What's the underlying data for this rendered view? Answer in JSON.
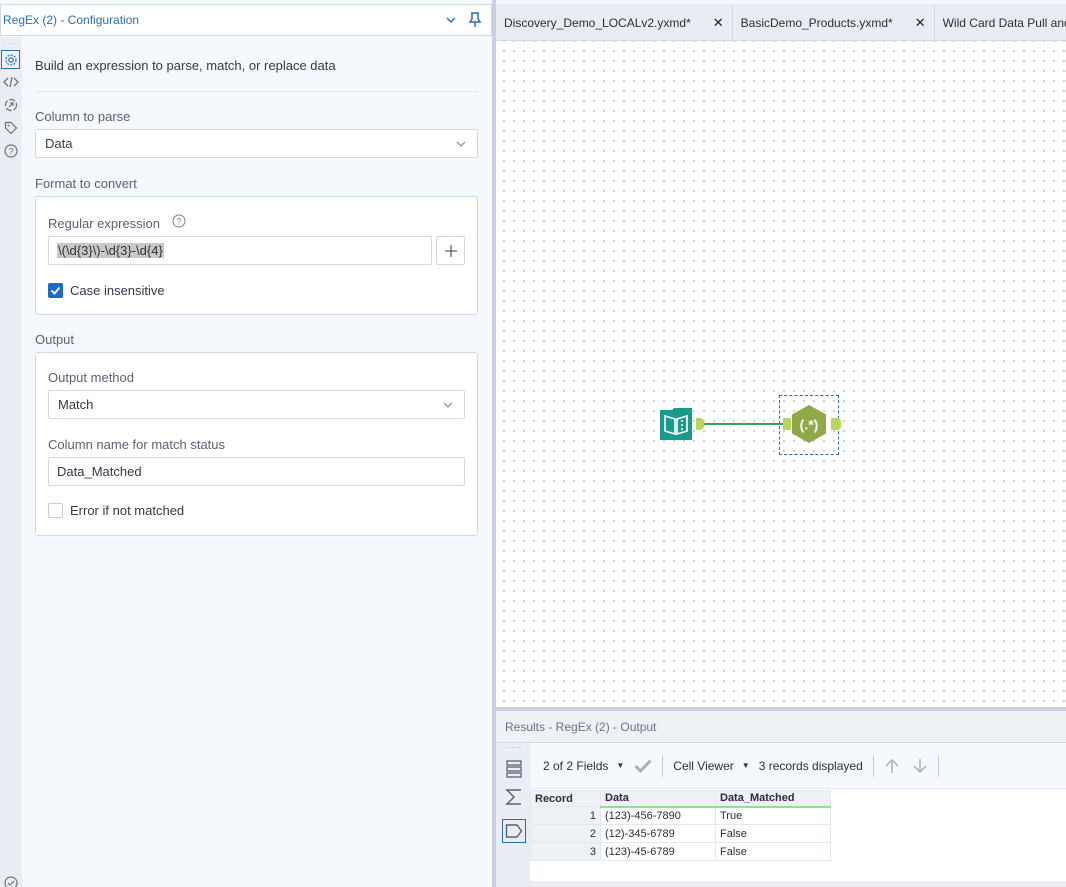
{
  "config": {
    "title": "RegEx (2) - Configuration",
    "description": "Build an expression to parse, match, or replace data",
    "column_to_parse": {
      "label": "Column to parse",
      "value": "Data"
    },
    "format_to_convert": {
      "label": "Format to convert",
      "regex_label": "Regular expression",
      "regex_value": "\\(\\d{3}\\)-\\d{3}-\\d{4}",
      "case_insensitive": {
        "label": "Case insensitive",
        "checked": true
      }
    },
    "output": {
      "label": "Output",
      "method_label": "Output method",
      "method_value": "Match",
      "match_column_label": "Column name for match status",
      "match_column_value": "Data_Matched",
      "error_if_not_matched": {
        "label": "Error if not matched",
        "checked": false
      }
    },
    "rail_icons": [
      "gear-icon",
      "code-icon",
      "run-icon",
      "tag-icon",
      "help-icon"
    ]
  },
  "tabs": [
    {
      "label": "Discovery_Demo_LOCALv2.yxmd*",
      "closable": true
    },
    {
      "label": "BasicDemo_Products.yxmd*",
      "closable": true
    },
    {
      "label": "Wild Card Data Pull and Parse",
      "closable": false
    }
  ],
  "canvas": {
    "tools": [
      {
        "name": "input-data-tool",
        "color": "#1a9a8a"
      },
      {
        "name": "regex-tool",
        "glyph": "(.*)",
        "color": "#8fa84a",
        "selected": true
      }
    ]
  },
  "results": {
    "header": "Results - RegEx (2) - Output",
    "toolbar": {
      "fields": "2 of 2 Fields",
      "viewer": "Cell Viewer",
      "records": "3 records displayed"
    },
    "columns": [
      "Record",
      "Data",
      "Data_Matched"
    ],
    "rows": [
      {
        "record": "1",
        "data": "(123)-456-7890",
        "matched": "True"
      },
      {
        "record": "2",
        "data": "(12)-345-6789",
        "matched": "False"
      },
      {
        "record": "3",
        "data": "(123)-45-6789",
        "matched": "False"
      }
    ]
  }
}
